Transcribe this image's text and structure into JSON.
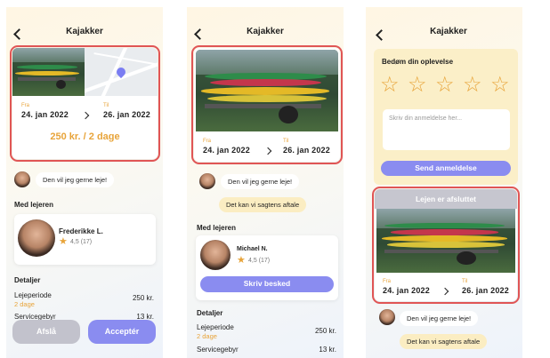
{
  "header": {
    "title": "Kajakker"
  },
  "dates": {
    "from_label": "Fra",
    "from": "24. jan 2022",
    "to_label": "Til",
    "to": "26. jan 2022"
  },
  "price": "250 kr. / 2 dage",
  "messages": {
    "renter": "Den vil jeg gerne leje!",
    "owner": "Det kan vi sagtens aftale"
  },
  "screen1": {
    "with_renter_title": "Med lejeren",
    "renter_name": "Frederikke L.",
    "rating": "4,5",
    "rating_count": "(17)",
    "details_title": "Detaljer",
    "rental_period_label": "Lejeperiode",
    "rental_period_days": "2 dage",
    "rental_period_value": "250 kr.",
    "service_fee_label": "Servicegebyr",
    "service_fee_value": "13 kr.",
    "decline_button": "Afslå",
    "accept_button": "Acceptér"
  },
  "screen2": {
    "with_renter_title": "Med lejeren",
    "renter_name": "Michael N.",
    "rating": "4,5",
    "rating_count": "(17)",
    "write_button": "Skriv besked",
    "details_title": "Detaljer",
    "rental_period_label": "Lejeperiode",
    "rental_period_days": "2 dage",
    "rental_period_value": "250 kr.",
    "service_fee_label": "Servicegebyr",
    "service_fee_value": "13 kr."
  },
  "screen3": {
    "review_title": "Bedøm din oplevelse",
    "review_placeholder": "Skriv din anmeldelse her...",
    "send_button": "Send anmeldelse",
    "completed_banner": "Lejen er afsluttet"
  },
  "icons": {
    "back": "chevron-left-icon",
    "arrow": "chevron-right-icon",
    "star": "star-icon",
    "pin": "map-pin-icon"
  },
  "colors": {
    "accent": "#e8a43a",
    "primary": "#8a8cf0",
    "highlight": "#e05555",
    "disabled": "#c2c2cc"
  }
}
